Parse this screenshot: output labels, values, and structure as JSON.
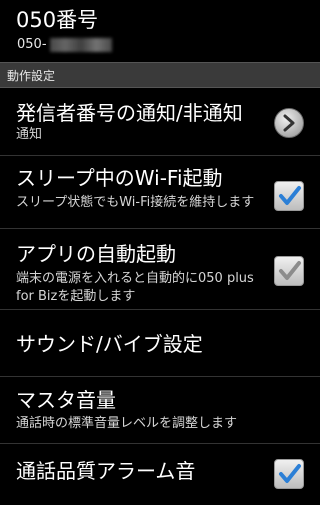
{
  "header": {
    "title": "050番号",
    "number_prefix": "050-"
  },
  "section": {
    "label": "動作設定"
  },
  "items": [
    {
      "title": "発信者番号の通知/非通知",
      "summary": "通知",
      "control": "arrow"
    },
    {
      "title": "スリープ中のWi-Fi起動",
      "summary": "スリープ状態でもWi-Fi接続を維持します",
      "checked": true
    },
    {
      "title": "アプリの自動起動",
      "summary": "端末の電源を入れると自動的に050 plus for Bizを起動します",
      "checked": false
    },
    {
      "title": "サウンド/バイブ設定"
    },
    {
      "title": "マスタ音量",
      "summary": "通話時の標準音量レベルを調整します"
    },
    {
      "title": "通話品質アラーム音",
      "checked": true
    }
  ],
  "colors": {
    "check_blue": "#2b7fd6",
    "check_gray": "#8c8c8c"
  }
}
